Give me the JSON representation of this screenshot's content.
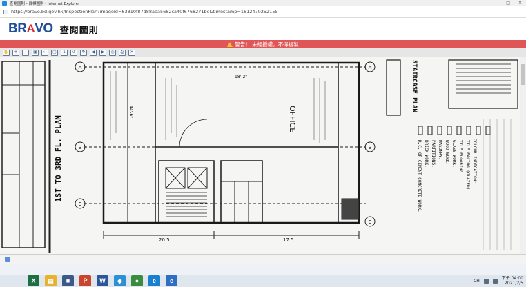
{
  "window": {
    "title": "查閱圖則 - 目標圖則 - Internet Explorer",
    "controls": [
      "—",
      "□",
      "✕"
    ]
  },
  "address_bar": {
    "url": "https://bravo.bd.gov.hk/InspectionPlan?imageId=63810f87d88aea5682ca40f6768271bc&timestamp=1612470252155"
  },
  "app": {
    "logo_main": "BR",
    "logo_accent": "A",
    "logo_tail": "VO",
    "title": "查閱圖則"
  },
  "warning": {
    "text": "警告！ 未經授權，不得複製",
    "icon": "warning-triangle-icon"
  },
  "toolbar": {
    "tools": [
      {
        "name": "pan-hand",
        "glyph": "✋"
      },
      {
        "name": "zoom-in",
        "glyph": "+"
      },
      {
        "name": "zoom-out",
        "glyph": "−"
      },
      {
        "name": "zoom-window",
        "glyph": "▣"
      },
      {
        "name": "fit-width",
        "glyph": "↔"
      },
      {
        "name": "fit-page",
        "glyph": "▢"
      },
      {
        "name": "actual-size",
        "glyph": "1"
      },
      {
        "name": "rotate-left",
        "glyph": "↺"
      },
      {
        "name": "rotate-right",
        "glyph": "↻"
      },
      {
        "name": "previous",
        "glyph": "◀"
      },
      {
        "name": "next",
        "glyph": "▶"
      },
      {
        "name": "magnifier",
        "glyph": "◎"
      },
      {
        "name": "print",
        "glyph": "⎙"
      },
      {
        "name": "close",
        "glyph": "✕"
      }
    ]
  },
  "drawing": {
    "plan_title": "1ST TO 3RD FL. PLAN",
    "room_label": "OFFICE",
    "staircase_label": "STAIRCASE PLAN",
    "grid_labels": [
      "A",
      "B",
      "C"
    ],
    "dimensions": [
      "20.5",
      "17.5",
      "18'-2\"",
      "44'-6\""
    ],
    "notes_title": "COLOUR INDICATION:",
    "notes": [
      "R.C. OR CEMENT CONCRETE WORK.",
      "BRICK WORK.",
      "PARTITIONS.",
      "MASONRY.",
      "WOOD WORK.",
      "GLASS WORK.",
      "TILE FLOORING.",
      "TILE FACING (GLAZED)."
    ]
  },
  "taskbar": {
    "apps": [
      {
        "name": "excel",
        "glyph": "X",
        "color": "#1d6f42"
      },
      {
        "name": "file-explorer",
        "glyph": "▤",
        "color": "#e8b22c"
      },
      {
        "name": "app-3",
        "glyph": "■",
        "color": "#3b5a8a"
      },
      {
        "name": "powerpoint",
        "glyph": "P",
        "color": "#c9462c"
      },
      {
        "name": "word",
        "glyph": "W",
        "color": "#2b579a"
      },
      {
        "name": "app-6",
        "glyph": "◆",
        "color": "#2d8fd5"
      },
      {
        "name": "chrome",
        "glyph": "●",
        "color": "#3a8d3e"
      },
      {
        "name": "edge",
        "glyph": "e",
        "color": "#1b7fcf"
      },
      {
        "name": "internet-explorer",
        "glyph": "e",
        "color": "#2f6fc3"
      }
    ],
    "tray": {
      "input_lang": "CH",
      "time_top": "下午 04:00",
      "time_bottom": "2021/2/5"
    }
  }
}
